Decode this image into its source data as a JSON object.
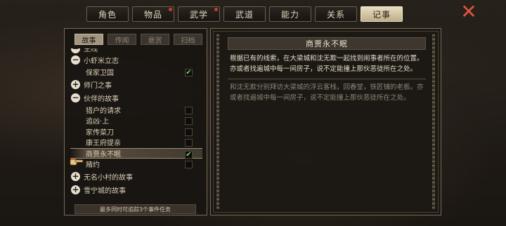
{
  "top_tabs": [
    {
      "label": "角色",
      "badge": false
    },
    {
      "label": "物品",
      "badge": true
    },
    {
      "label": "武学",
      "badge": true
    },
    {
      "label": "武道",
      "badge": false
    },
    {
      "label": "能力",
      "badge": false
    },
    {
      "label": "关系",
      "badge": false
    },
    {
      "label": "记事",
      "badge": false,
      "active": true
    }
  ],
  "close_icon": "close-x-icon",
  "sub_tabs": [
    {
      "label": "故事",
      "active": true
    },
    {
      "label": "传闻",
      "active": false
    },
    {
      "label": "悬赏",
      "active": false
    },
    {
      "label": "扫档",
      "active": false
    }
  ],
  "quests": {
    "cut_top": "主线",
    "section1": {
      "label": "小虾米立志",
      "expanded": true
    },
    "s1_item1": {
      "label": "保家卫国",
      "tracked": true
    },
    "section2": {
      "label": "师门之事",
      "expanded": false
    },
    "section3": {
      "label": "伙伴的故事",
      "expanded": true
    },
    "s3_item1": {
      "label": "猎户的请求",
      "tracked": false
    },
    "s3_item2": {
      "label": "追凶·上",
      "tracked": false
    },
    "s3_item3": {
      "label": "家传菜刀",
      "tracked": false
    },
    "s3_item4": {
      "label": "康王府提亲",
      "tracked": false
    },
    "s3_item5": {
      "label": "商贾永不眠",
      "tracked": true,
      "selected": true
    },
    "s3_item6": {
      "label": "赌约",
      "tracked": false
    },
    "section4": {
      "label": "无名小村的故事",
      "expanded": false
    },
    "section5": {
      "label": "雪宁城的故事",
      "expanded": false
    }
  },
  "footer_text": "最多同时可追踪3个事件任务",
  "detail": {
    "title": "商贾永不眠",
    "current_text": "根据已有的线索，在大梁城和沈无欺一起找到闹事者所在的位置。亦或者找遍城中每一间房子，说不定能撞上那伙恶徒所在之处。",
    "previous_text": "和沈无欺分别拜访大梁城的浮云客栈，回春堂，铁匠铺的老板。亦或者找遍城中每一间房子，说不定能撞上那伙恶徒所在之处。"
  },
  "colors": {
    "check": "#6fd06a",
    "close": "#e0533e",
    "badge": "#d23a2a",
    "active_tab": "#e9dcc0"
  }
}
